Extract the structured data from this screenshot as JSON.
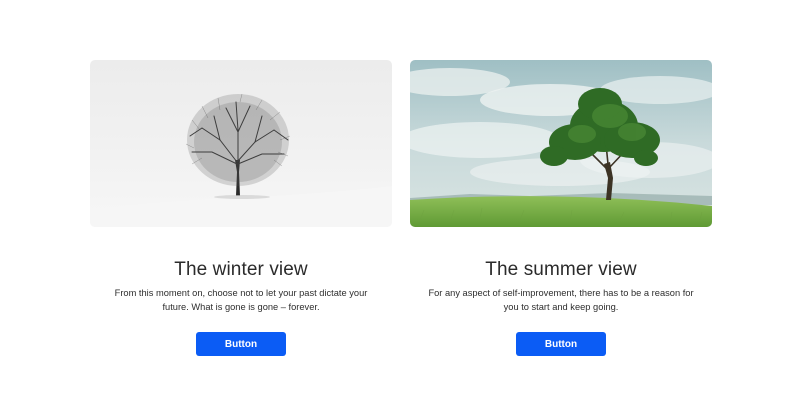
{
  "cards": [
    {
      "title": "The winter view",
      "description": "From this moment on, choose not to let your past dictate your future. What is gone is gone – forever.",
      "button_label": "Button",
      "image": "winter-tree-image"
    },
    {
      "title": "The summer view",
      "description": "For any aspect of self-improvement, there has to be a reason for you to start and keep going.",
      "button_label": "Button",
      "image": "summer-tree-image"
    }
  ],
  "colors": {
    "button": "#0b5cf5",
    "button_text": "#ffffff",
    "text": "#2b2b2b",
    "background": "#ffffff"
  }
}
